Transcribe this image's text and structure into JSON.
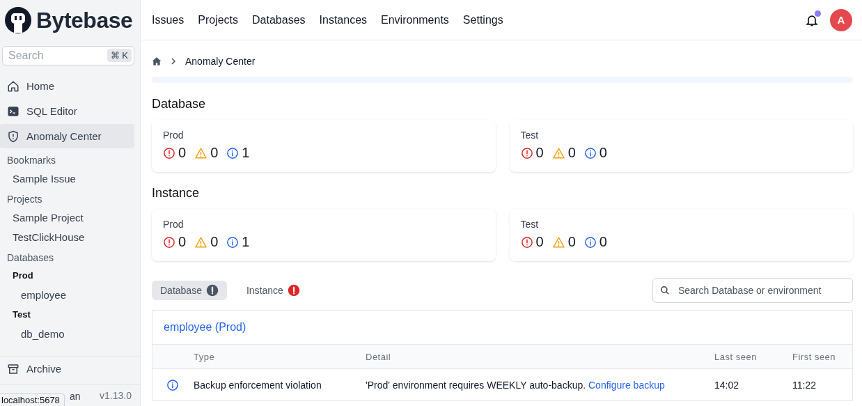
{
  "logo": {
    "text": "Bytebase"
  },
  "nav": [
    {
      "label": "Issues"
    },
    {
      "label": "Projects"
    },
    {
      "label": "Databases"
    },
    {
      "label": "Instances"
    },
    {
      "label": "Environments"
    },
    {
      "label": "Settings"
    }
  ],
  "header": {
    "unread": true,
    "avatar": "A"
  },
  "sidebar": {
    "search": {
      "placeholder": "Search",
      "shortcut": "⌘ K"
    },
    "items": [
      {
        "label": "Home",
        "kind": "home",
        "selected": false
      },
      {
        "label": "SQL Editor",
        "kind": "editor",
        "selected": false
      },
      {
        "label": "Anomaly Center",
        "kind": "anomaly",
        "selected": true
      }
    ],
    "sections": [
      {
        "title": "Bookmarks",
        "items": [
          {
            "label": "Sample Issue"
          }
        ]
      },
      {
        "title": "Projects",
        "items": [
          {
            "label": "Sample Project"
          },
          {
            "label": "TestClickHouse"
          }
        ]
      },
      {
        "title": "Databases",
        "items": [
          {
            "label": "Prod",
            "children": [
              {
                "label": "employee"
              }
            ]
          },
          {
            "label": "Test",
            "children": [
              {
                "label": "db_demo"
              }
            ]
          }
        ]
      }
    ],
    "archive": {
      "label": "Archive"
    },
    "footer": {
      "plan": "an",
      "version": "v1.13.0"
    }
  },
  "status_tooltip": "localhost:5678",
  "breadcrumb": [
    {
      "label": "Anomaly Center"
    }
  ],
  "sections": [
    {
      "title": "Database",
      "cards": [
        {
          "environment": "Prod",
          "errors": "0",
          "warnings": "0",
          "infos": "1"
        },
        {
          "environment": "Test",
          "errors": "0",
          "warnings": "0",
          "infos": "0"
        }
      ]
    },
    {
      "title": "Instance",
      "cards": [
        {
          "environment": "Prod",
          "errors": "0",
          "warnings": "0",
          "infos": "1"
        },
        {
          "environment": "Test",
          "errors": "0",
          "warnings": "0",
          "infos": "0"
        }
      ]
    }
  ],
  "tabs": [
    {
      "label": "Database",
      "selected": true,
      "color": "#4b5563"
    },
    {
      "label": "Instance",
      "selected": false,
      "color": "#dc2626"
    }
  ],
  "table_search": {
    "placeholder": "Search Database or environment"
  },
  "anomaly_group": {
    "title": "employee (Prod)",
    "columns": [
      "Type",
      "Detail",
      "Last seen",
      "First seen"
    ],
    "rows": [
      {
        "kind": "info",
        "type": "Backup enforcement violation",
        "detail": "'Prod' environment requires WEEKLY auto-backup.",
        "action": "Configure backup",
        "last_seen": "14:02",
        "first_seen": "11:22"
      }
    ]
  }
}
